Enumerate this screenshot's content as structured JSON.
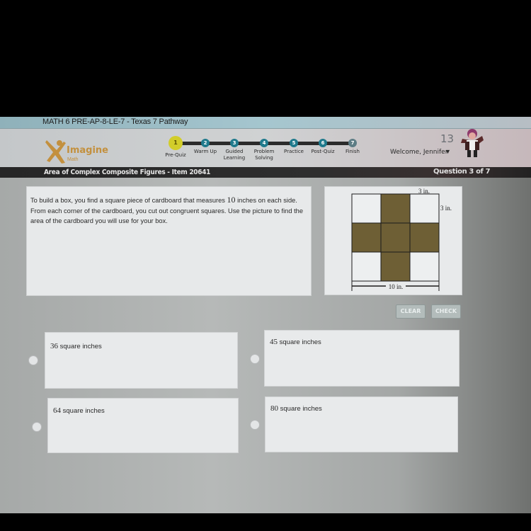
{
  "app": {
    "course_title": "MATH 6 PRE-AP-8-LE-7 - Texas 7 Pathway",
    "logo": {
      "name": "Imagine",
      "sub": "Math",
      "color": "#c3903e"
    }
  },
  "progress": {
    "current_step": 1,
    "steps": [
      {
        "number": "1",
        "label": "Pre-Quiz"
      },
      {
        "number": "2",
        "label": "Warm Up"
      },
      {
        "number": "3",
        "label": "Guided Learning"
      },
      {
        "number": "4",
        "label": "Problem Solving"
      },
      {
        "number": "5",
        "label": "Practice"
      },
      {
        "number": "6",
        "label": "Post-Quiz"
      },
      {
        "number": "7",
        "label": "Finish"
      }
    ],
    "active_color": "#d2cd2a",
    "step_color": "#1f7a8c"
  },
  "user": {
    "score": "13",
    "welcome": "Welcome, Jennifer",
    "menu_icon": "caret-down-icon"
  },
  "lesson": {
    "title": "Area of Complex Composite Figures - Item 20641",
    "question_counter": "Question 3 of 7"
  },
  "question": {
    "text_before": "To build a box, you find a square piece of cardboard that measures ",
    "number": "10",
    "text_after": " inches on each side. From each corner of the cardboard, you cut out congruent squares. Use the picture to find the area of the cardboard you will use for your box."
  },
  "figure": {
    "top_label": "3 in.",
    "side_label": "3 in.",
    "bottom_label": "10 in.",
    "shaded_color": "#6e5f35"
  },
  "buttons": {
    "clear": "CLEAR",
    "check": "CHECK"
  },
  "answers": [
    {
      "number": "36",
      "unit": " square inches"
    },
    {
      "number": "45",
      "unit": " square inches"
    },
    {
      "number": "64",
      "unit": " square inches"
    },
    {
      "number": "80",
      "unit": " square inches"
    }
  ]
}
